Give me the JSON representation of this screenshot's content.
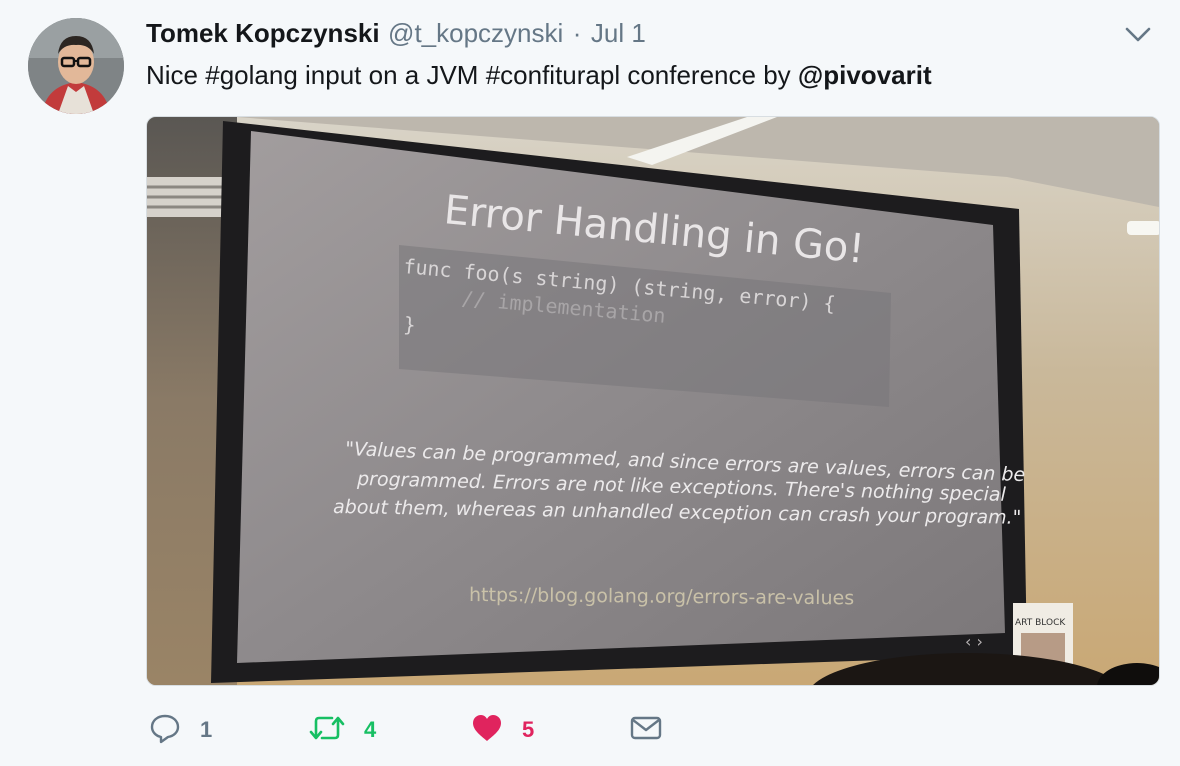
{
  "tweet": {
    "author_name": "Tomek Kopczynski",
    "handle": "@t_kopczynski",
    "separator": "·",
    "time": "Jul 1",
    "text_parts": [
      "Nice ",
      "#golang",
      " input on a JVM ",
      "#confiturapl",
      " conference by ",
      "@pivovarit"
    ]
  },
  "slide": {
    "title": "Error Handling in Go!",
    "code_line1": "func foo(s string) (string, error) {",
    "code_line2": "// implementation",
    "code_line3": "}",
    "quote_line1": "\"Values can be programmed, and since errors are values, errors can be",
    "quote_line2": "programmed. Errors are not like exceptions. There's nothing special",
    "quote_line3": "about them, whereas an unhandled exception can crash your program.\"",
    "url": "https://blog.golang.org/errors-are-values",
    "sign": "ART BLOCK"
  },
  "actions": {
    "reply_count": "1",
    "retweet_count": "4",
    "like_count": "5"
  },
  "colors": {
    "link": "#1b95e0",
    "retweet": "#17bf63",
    "like": "#e0245e",
    "muted": "#657786"
  },
  "icons": [
    "chevron-down-icon",
    "reply-icon",
    "retweet-icon",
    "heart-icon",
    "mail-icon"
  ]
}
